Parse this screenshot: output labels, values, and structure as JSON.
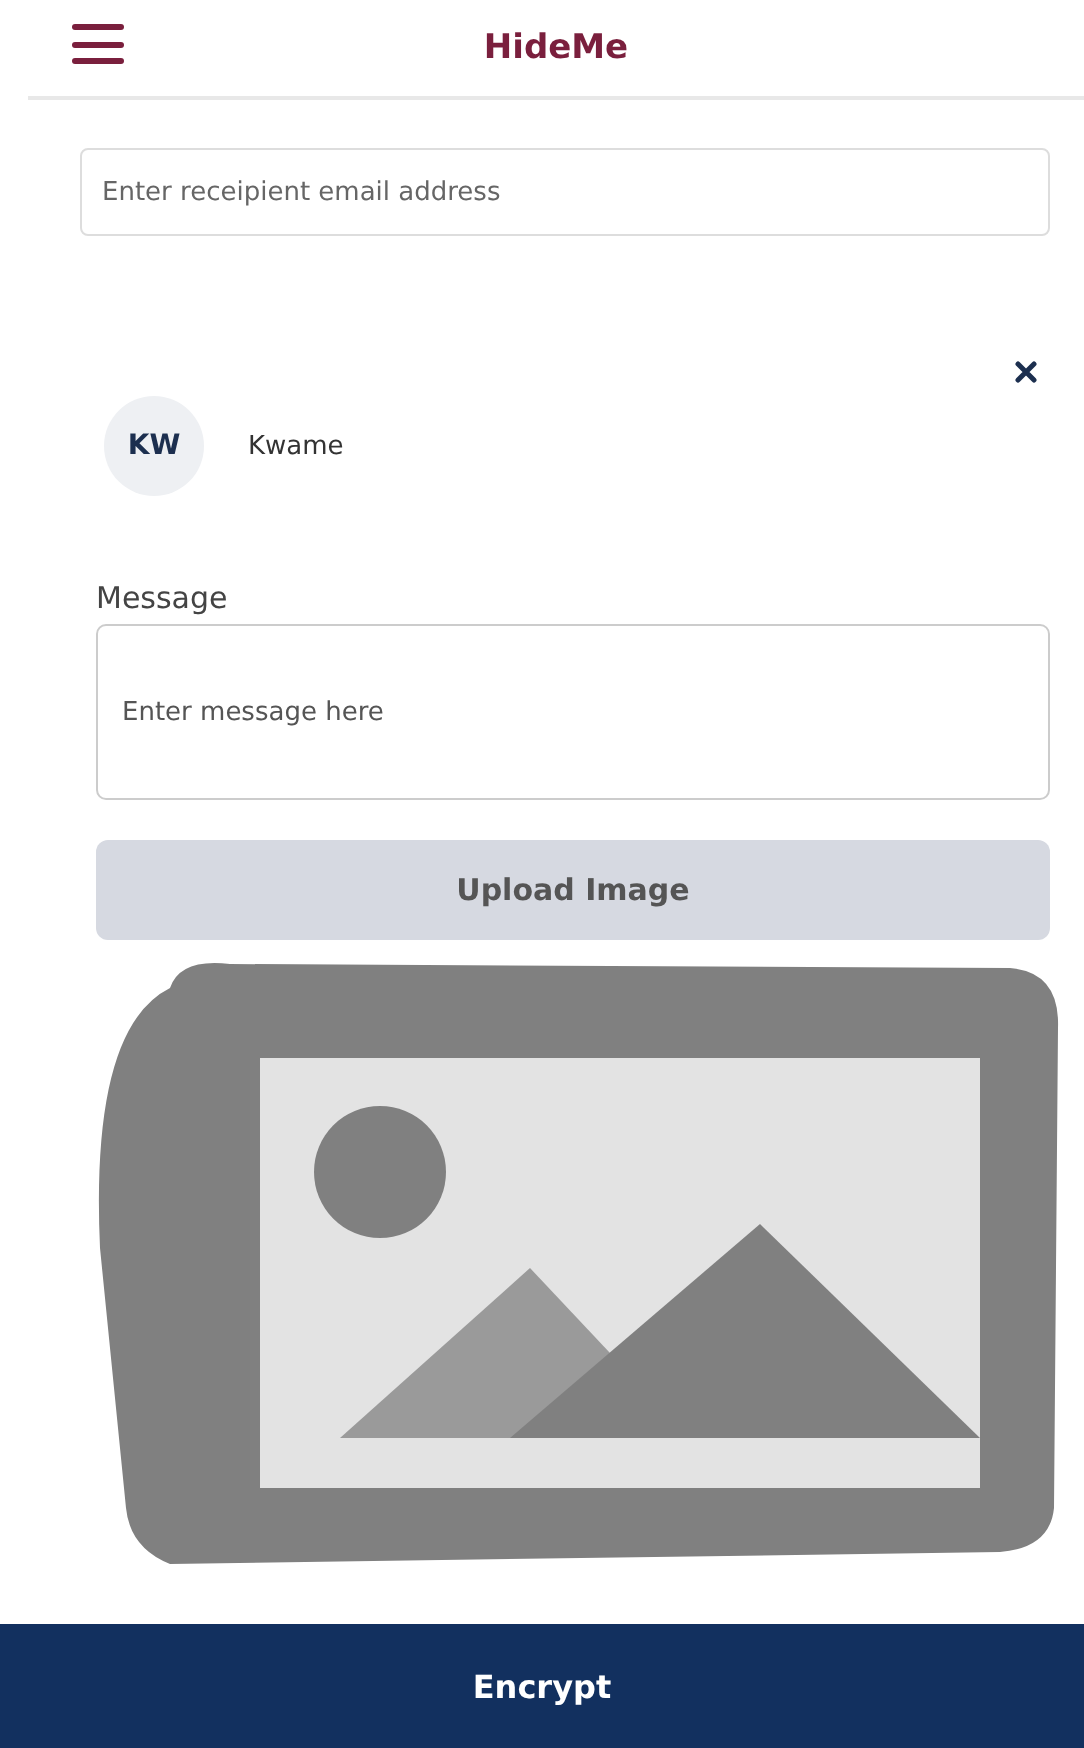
{
  "header": {
    "title": "HideMe"
  },
  "recipient_field": {
    "placeholder": "Enter receipient email address"
  },
  "recipient": {
    "initials": "KW",
    "name": "Kwame"
  },
  "message": {
    "label": "Message",
    "placeholder": "Enter message here"
  },
  "upload_button": "Upload Image",
  "preview": {
    "kind": "placeholder"
  },
  "encrypt_button": "Encrypt"
}
